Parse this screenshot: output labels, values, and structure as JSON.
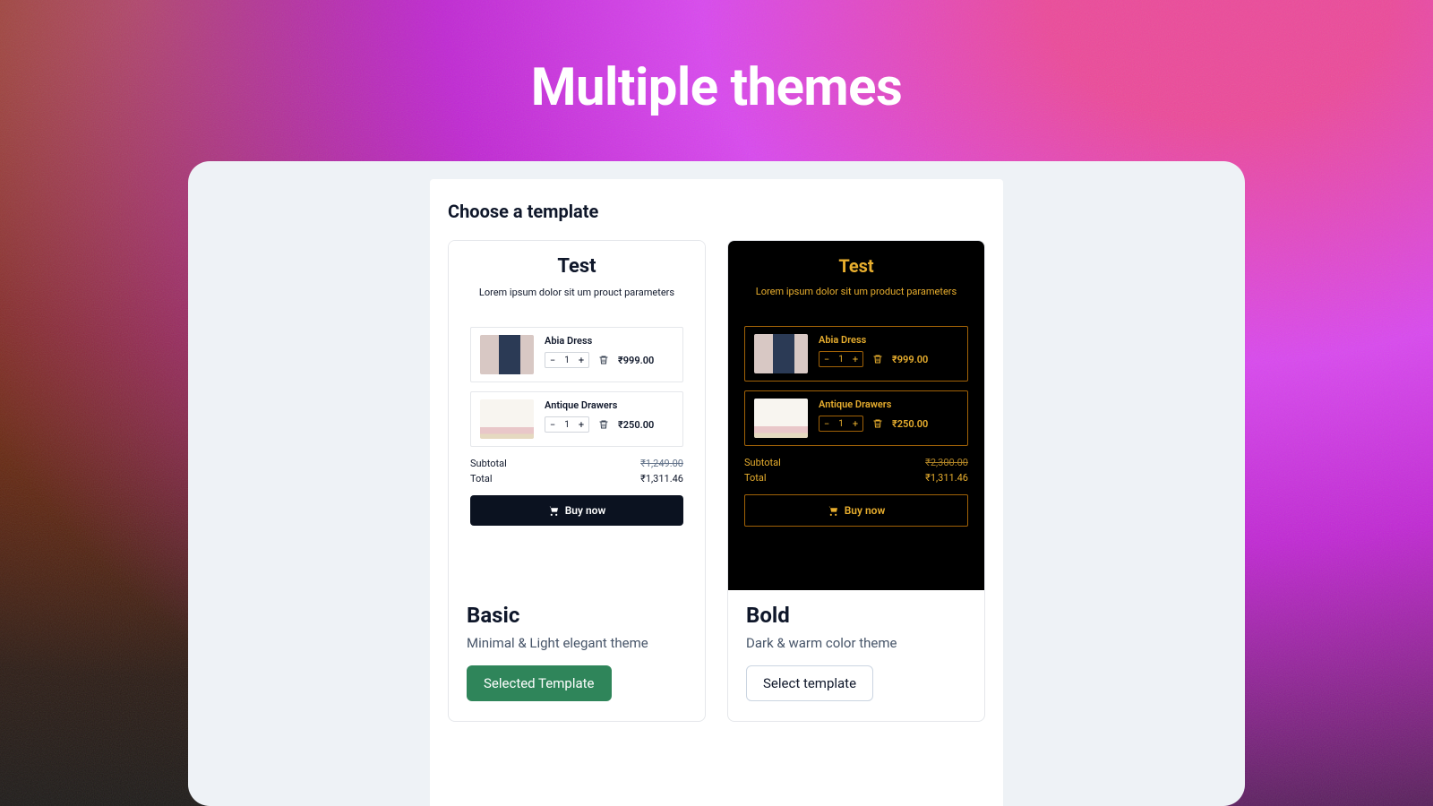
{
  "hero": {
    "title": "Multiple themes"
  },
  "panel": {
    "title": "Choose a template"
  },
  "templates": [
    {
      "name": "Basic",
      "description": "Minimal & Light elegant theme",
      "button_label": "Selected Template",
      "selected": true,
      "preview": {
        "title": "Test",
        "subtitle": "Lorem ipsum dolor sit um prouct parameters",
        "items": [
          {
            "name": "Abia Dress",
            "quantity": 1,
            "price": "₹999.00"
          },
          {
            "name": "Antique Drawers",
            "quantity": 1,
            "price": "₹250.00"
          }
        ],
        "subtotal_label": "Subtotal",
        "subtotal_value": "₹1,249.00",
        "total_label": "Total",
        "total_value": "₹1,311.46",
        "buy_label": "Buy now"
      }
    },
    {
      "name": "Bold",
      "description": "Dark & warm color theme",
      "button_label": "Select template",
      "selected": false,
      "preview": {
        "title": "Test",
        "subtitle": "Lorem ipsum dolor sit um product parameters",
        "items": [
          {
            "name": "Abia Dress",
            "quantity": 1,
            "price": "₹999.00"
          },
          {
            "name": "Antique Drawers",
            "quantity": 1,
            "price": "₹250.00"
          }
        ],
        "subtotal_label": "Subtotal",
        "subtotal_value": "₹2,300.00",
        "total_label": "Total",
        "total_value": "₹1,311.46",
        "buy_label": "Buy now"
      }
    }
  ],
  "icons": {
    "cart": "cart-icon",
    "trash": "trash-icon",
    "minus": "−",
    "plus": "+"
  }
}
